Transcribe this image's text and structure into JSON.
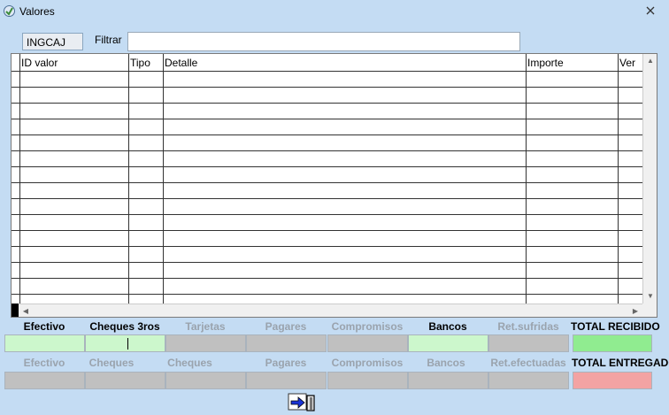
{
  "window": {
    "title": "Valores",
    "close_glyph": "✕"
  },
  "filter": {
    "code": "INGCAJ",
    "label": "Filtrar",
    "value": ""
  },
  "grid": {
    "columns": [
      "ID valor",
      "Tipo",
      "Detalle",
      "Importe",
      "Ver"
    ],
    "row_count": 15
  },
  "received": {
    "labels": [
      "Efectivo",
      "Cheques 3ros",
      "Tarjetas",
      "Pagares",
      "Compromisos",
      "Bancos",
      "Ret.sufridas"
    ],
    "enabled": [
      true,
      true,
      false,
      false,
      false,
      true,
      false
    ],
    "total_label": "TOTAL RECIBIDO"
  },
  "delivered": {
    "labels": [
      "Efectivo",
      "Cheques",
      "Cheques",
      "Pagares",
      "Compromisos",
      "Bancos",
      "Ret.efectuadas"
    ],
    "enabled": [
      false,
      false,
      false,
      false,
      false,
      false,
      false
    ],
    "total_label": "TOTAL ENTREGADO"
  },
  "colors": {
    "background": "#c4dcf3",
    "enabled_field": "#ccf7cc",
    "disabled_field": "#c0c0c0",
    "total_received": "#90ec90",
    "total_delivered": "#f3a3a3"
  },
  "icons": {
    "app": "app-logo-icon",
    "close": "close-icon",
    "exit": "exit-door-icon"
  }
}
